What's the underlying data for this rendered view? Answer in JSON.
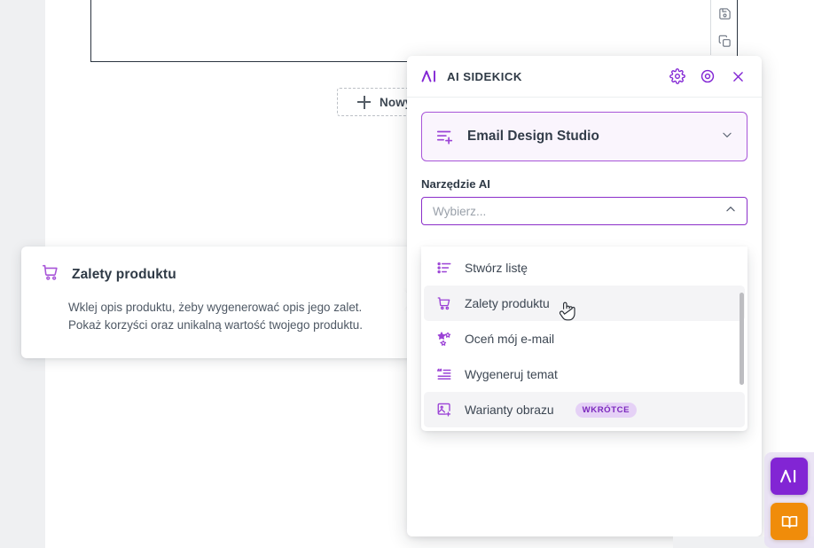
{
  "app": {
    "new_widget_label": "Nowy widget",
    "tools": [
      {
        "name": "save-icon",
        "title": "Zapisz"
      },
      {
        "name": "copy-icon",
        "title": "Kopiuj"
      }
    ]
  },
  "info_card": {
    "icon": "shopping-cart-icon",
    "title": "Zalety produktu",
    "description": "Wklej opis produktu, żeby wygenerować opis jego zalet. Pokaż korzyści oraz unikalną wartość twojego produktu."
  },
  "panel": {
    "logo": "ai-sidekick-logo",
    "title": "AI SIDEKICK",
    "header_actions": [
      {
        "name": "gear-icon",
        "label": "Ustawienia"
      },
      {
        "name": "target-icon",
        "label": "Zaznacz element"
      },
      {
        "name": "close-icon",
        "label": "Zamknij"
      }
    ],
    "studio": {
      "icon": "list-plus-icon",
      "label": "Email Design Studio",
      "chevron": "chevron-down-icon"
    },
    "tool_field": {
      "label": "Narzędzie AI",
      "placeholder": "Wybierz...",
      "value": "",
      "caret": "chevron-up-icon"
    },
    "dropdown": {
      "scroll_visible": true,
      "options": [
        {
          "icon": "list-icon",
          "label": "Stwórz listę",
          "badge": "",
          "highlighted": false
        },
        {
          "icon": "shopping-cart-icon",
          "label": "Zalety produktu",
          "badge": "",
          "highlighted": true
        },
        {
          "icon": "sparkle-stars-icon",
          "label": "Oceń mój e-mail",
          "badge": "",
          "highlighted": false
        },
        {
          "icon": "quote-lines-icon",
          "label": "Wygeneruj temat",
          "badge": "",
          "highlighted": false
        },
        {
          "icon": "image-plus-icon",
          "label": "Warianty obrazu",
          "badge": "WKRÓTCE",
          "highlighted": true
        }
      ]
    }
  },
  "launcher": {
    "ai_button": {
      "name": "ai-sidekick-fab",
      "label": "AI"
    },
    "book_button": {
      "name": "knowledge-book-fab",
      "label": "Book"
    }
  },
  "colors": {
    "accent_purple": "#8225d4",
    "accent_purple_light": "#a855d8",
    "badge_bg": "#e5d1f6",
    "badge_text": "#7b28bd",
    "orange": "#f08c0a",
    "rail_grey": "#eff0f2"
  }
}
